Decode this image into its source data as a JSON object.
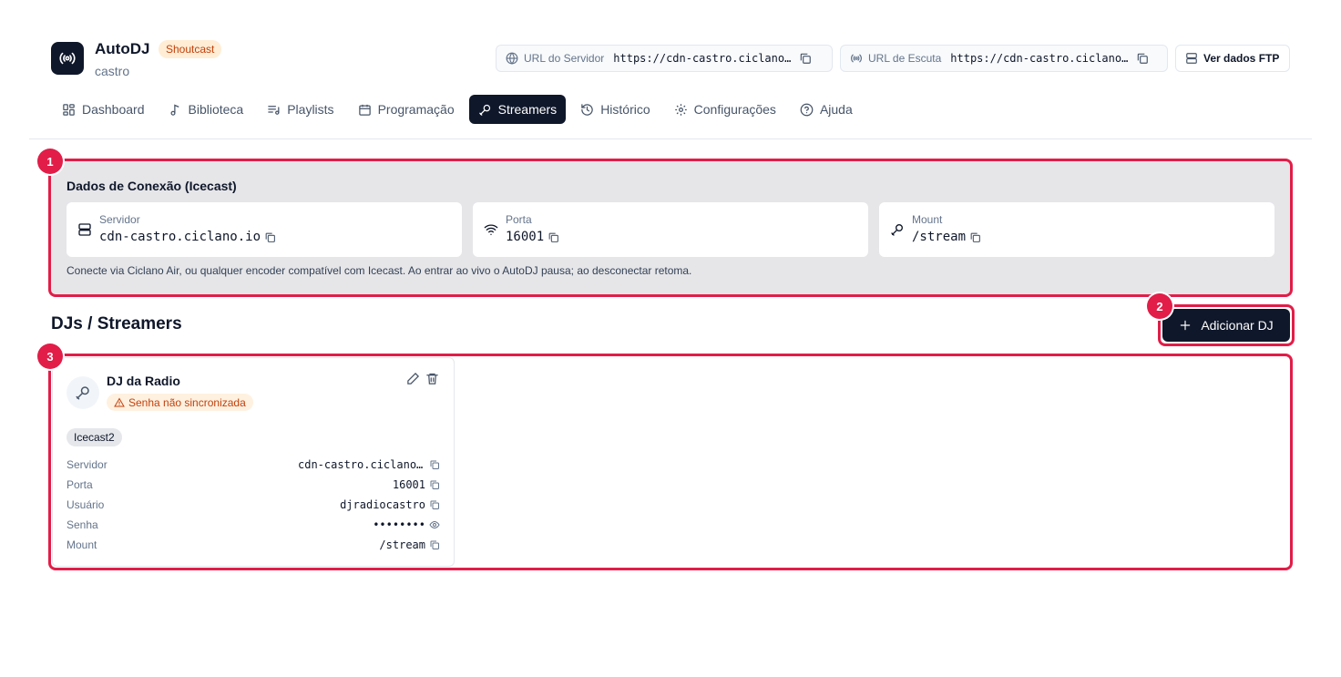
{
  "header": {
    "app_title": "AutoDJ",
    "badge": "Shoutcast",
    "subtitle": "castro",
    "server_url_label": "URL do Servidor",
    "server_url_value": "https://cdn-castro.ciclano.io",
    "listen_url_label": "URL de Escuta",
    "listen_url_value": "https://cdn-castro.ciclano.io",
    "ftp_button": "Ver dados FTP"
  },
  "nav": {
    "tabs": [
      {
        "label": "Dashboard",
        "icon": "dashboard-icon"
      },
      {
        "label": "Biblioteca",
        "icon": "music-note-icon"
      },
      {
        "label": "Playlists",
        "icon": "playlist-icon"
      },
      {
        "label": "Programação",
        "icon": "calendar-icon"
      },
      {
        "label": "Streamers",
        "icon": "microphone-icon",
        "active": true
      },
      {
        "label": "Histórico",
        "icon": "history-icon"
      },
      {
        "label": "Configurações",
        "icon": "gear-icon"
      },
      {
        "label": "Ajuda",
        "icon": "help-circle-icon"
      }
    ]
  },
  "connection": {
    "title": "Dados de Conexão (Icecast)",
    "server_label": "Servidor",
    "server_value": "cdn-castro.ciclano.io",
    "port_label": "Porta",
    "port_value": "16001",
    "mount_label": "Mount",
    "mount_value": "/stream",
    "note": "Conecte via Ciclano Air, ou qualquer encoder compatível com Icecast. Ao entrar ao vivo o AutoDJ pausa; ao desconectar retoma."
  },
  "djs": {
    "title": "DJs / Streamers",
    "add_button": "Adicionar DJ",
    "items": [
      {
        "name": "DJ da Radio",
        "status": "Senha não sincronizada",
        "protocol": "Icecast2",
        "fields": [
          {
            "label": "Servidor",
            "value": "cdn-castro.ciclano.io",
            "action": "copy-icon"
          },
          {
            "label": "Porta",
            "value": "16001",
            "action": "copy-icon"
          },
          {
            "label": "Usuário",
            "value": "djradiocastro",
            "action": "copy-icon"
          },
          {
            "label": "Senha",
            "value": "••••••••",
            "action": "eye-icon"
          },
          {
            "label": "Mount",
            "value": "/stream",
            "action": "copy-icon"
          }
        ]
      }
    ]
  },
  "annotations": [
    "1",
    "2",
    "3"
  ],
  "colors": {
    "primary": "#0f172a",
    "highlight": "#e11d48",
    "warning_bg": "#fff1e0",
    "warning_text": "#c2410c"
  }
}
